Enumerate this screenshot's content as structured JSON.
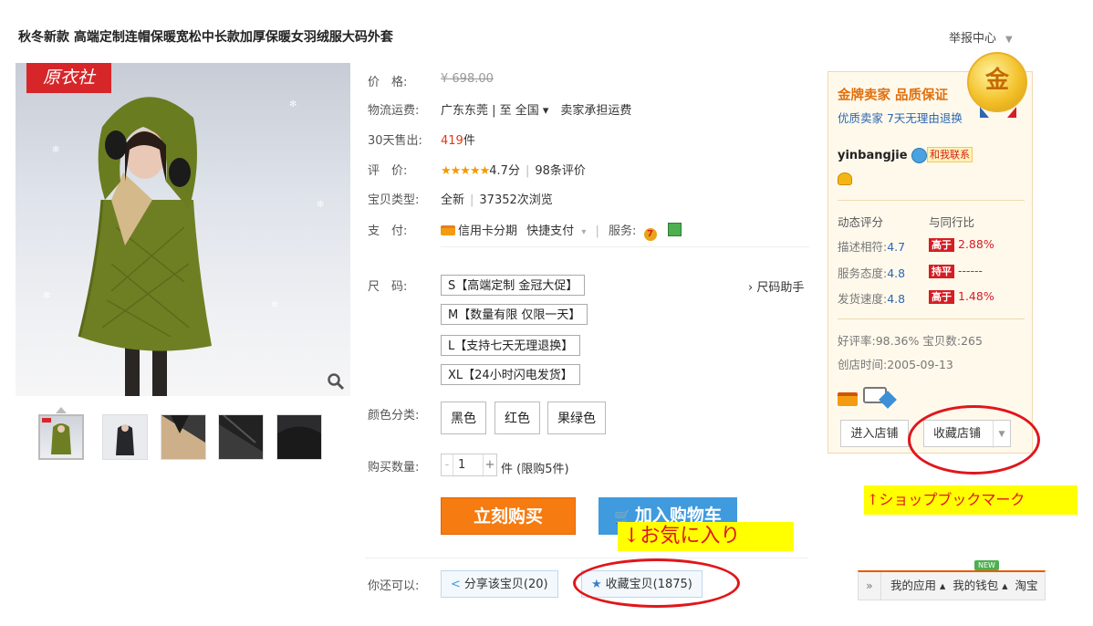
{
  "title": "秋冬新款 高端定制连帽保暖宽松中长款加厚保暖女羽绒服大码外套",
  "report_center": "举报中心",
  "brand_logo": "原衣社",
  "props": {
    "price_label": "价　格:",
    "price_value": "¥ 698.00",
    "shipping_label": "物流运费:",
    "shipping_value": "广东东莞 | 至 全国 ▾　卖家承担运费",
    "sales_label": "30天售出:",
    "sales_count": "419",
    "sales_unit": "件",
    "rating_label": "评　价:",
    "rating_stars": "★★★★★",
    "rating_score": "4.7分",
    "rating_reviews": "98条评价",
    "type_label": "宝贝类型:",
    "type_value": "全新",
    "type_views": "37352次浏览",
    "payment_label": "支　付:",
    "payment_installment": "信用卡分期",
    "payment_quick": "快捷支付",
    "services_label": "服务:",
    "size_label": "尺　码:",
    "size_helper": "› 尺码助手",
    "color_label": "颜色分类:",
    "quantity_label": "购买数量:",
    "quantity_value": "1",
    "quantity_unit": "件 (限购5件)",
    "share_label": "你还可以:"
  },
  "sizes": [
    "S【高端定制 金冠大促】",
    "M【数量有限 仅限一天】",
    "L【支持七天无理退换】",
    "XL【24小时闪电发货】"
  ],
  "colors": [
    "黑色",
    "红色",
    "果绿色"
  ],
  "buttons": {
    "buy_now": "立刻购买",
    "add_cart": "加入购物车",
    "share": "分享该宝贝(20)",
    "favorite": "收藏宝贝(1875)"
  },
  "annotations": {
    "favorite_note": "↓お気に入り",
    "shop_note": "↑ショップブックマーク"
  },
  "seller": {
    "badge_title": "金牌卖家 品质保证",
    "badge_sub": "优质卖家 7天无理由退换",
    "medal_text": "金",
    "name": "yinbangjie",
    "contact": "和我联系",
    "dsr_header": "动态评分",
    "compare_header": "与同行比",
    "ratings": [
      {
        "label": "描述相符:",
        "score": "4.7",
        "tag": "高于",
        "value": "2.88%"
      },
      {
        "label": "服务态度:",
        "score": "4.8",
        "tag": "持平",
        "value": "------"
      },
      {
        "label": "发货速度:",
        "score": "4.8",
        "tag": "高于",
        "value": "1.48%"
      }
    ],
    "good_rate": "好评率:98.36%",
    "item_count": "宝贝数:265",
    "founded": "创店时间:2005-09-13",
    "enter_shop": "进入店铺",
    "fav_shop": "收藏店铺"
  },
  "app_bar": {
    "new_badge": "NEW",
    "expand": "»",
    "my_apps": "我的应用 ▴",
    "my_wallet": "我的钱包 ▴",
    "taobao": "淘宝"
  },
  "colors_theme": {
    "accent_orange": "#f67b10",
    "accent_blue": "#3f9ade",
    "highlight_red": "#e0161b",
    "note_yellow": "#ffff00"
  }
}
